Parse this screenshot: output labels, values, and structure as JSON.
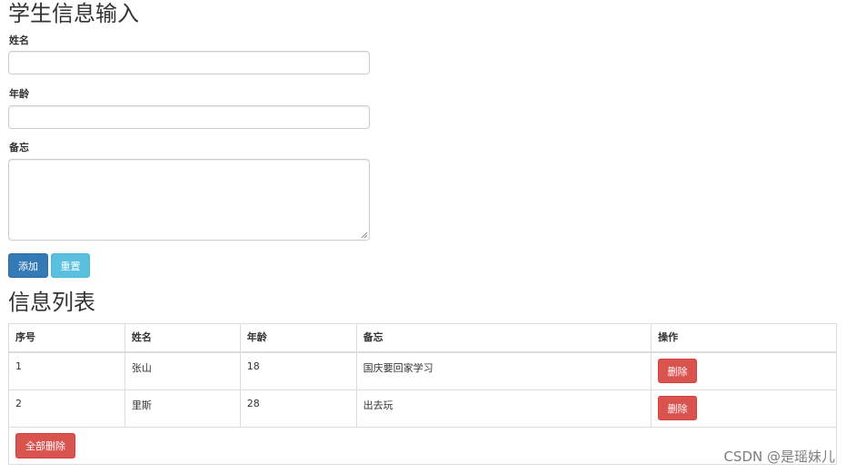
{
  "form": {
    "title": "学生信息输入",
    "fields": {
      "name": {
        "label": "姓名",
        "value": "",
        "placeholder": ""
      },
      "age": {
        "label": "年龄",
        "value": "",
        "placeholder": ""
      },
      "memo": {
        "label": "备忘",
        "value": "",
        "placeholder": ""
      }
    },
    "buttons": {
      "add": "添加",
      "reset": "重置"
    }
  },
  "list": {
    "title": "信息列表",
    "columns": [
      "序号",
      "姓名",
      "年龄",
      "备忘",
      "操作"
    ],
    "rows": [
      {
        "index": "1",
        "name": "张山",
        "age": "18",
        "memo": "国庆要回家学习",
        "action": "删除"
      },
      {
        "index": "2",
        "name": "里斯",
        "age": "28",
        "memo": "出去玩",
        "action": "删除"
      }
    ],
    "clear_all": "全部删除"
  },
  "watermark": "CSDN @是瑶妹儿",
  "colors": {
    "primary": "#337ab7",
    "info": "#5bc0de",
    "danger": "#d9534f",
    "border": "#dddddd"
  }
}
